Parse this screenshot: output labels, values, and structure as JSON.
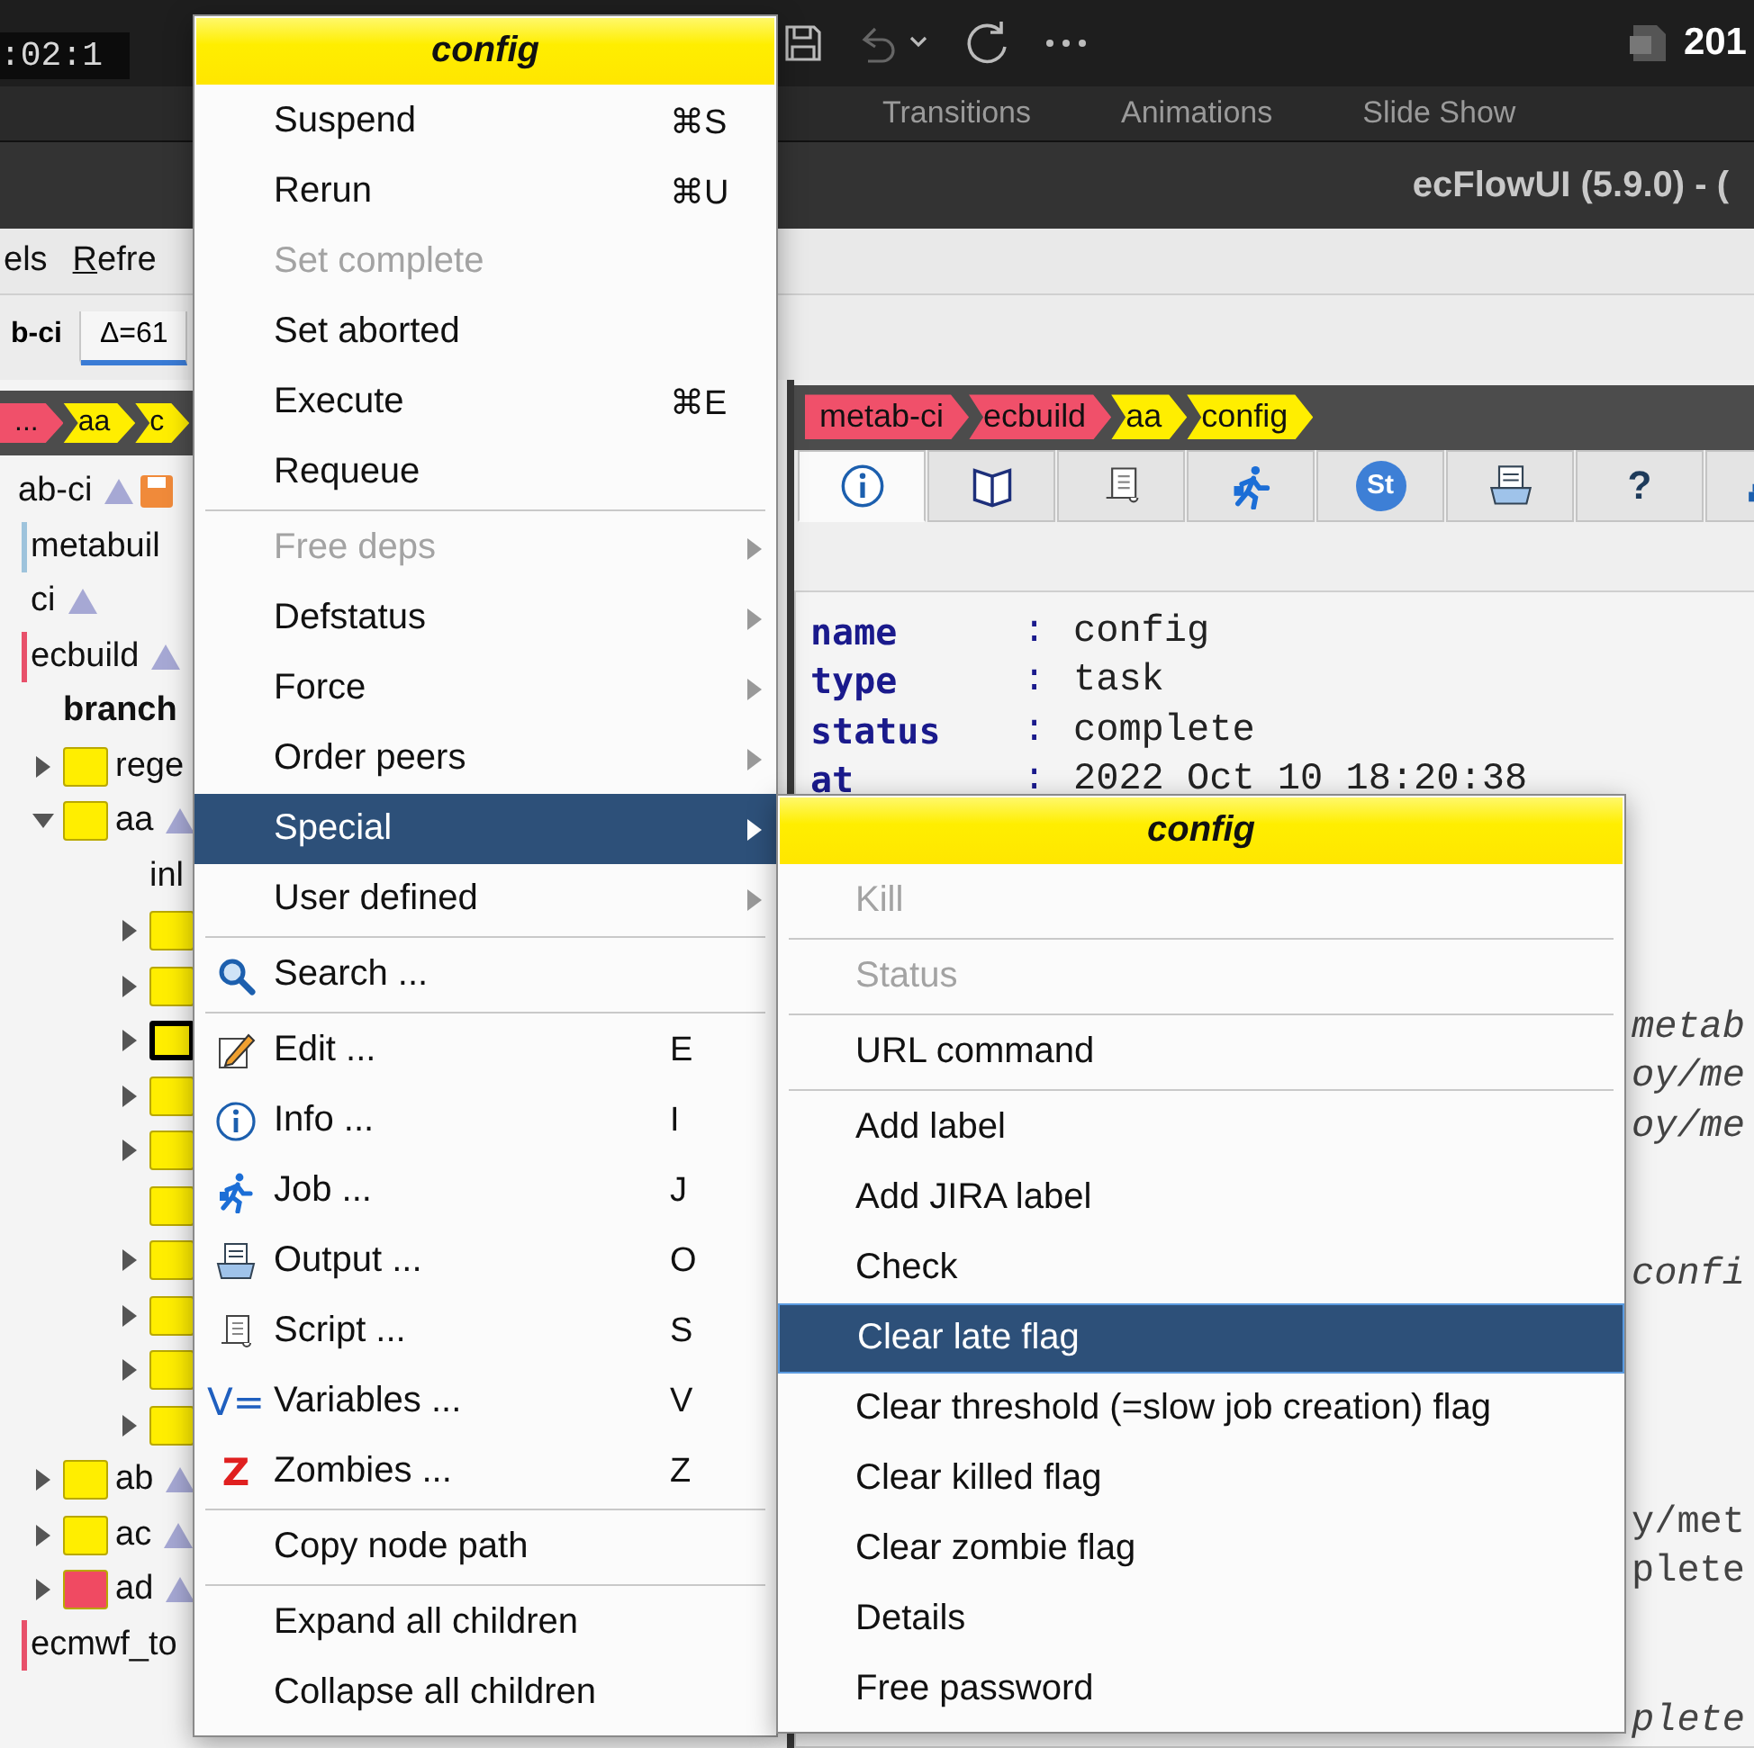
{
  "topbar": {
    "timer": ":02:1",
    "doc_title": "201"
  },
  "ribbon_tabs": [
    "Transitions",
    "Animations",
    "Slide Show"
  ],
  "window": {
    "title": "ecFlowUI (5.9.0) - ("
  },
  "menubar": [
    {
      "label": "els"
    },
    {
      "label": "Refre"
    }
  ],
  "server_tabs": [
    {
      "label": "b-ci",
      "selected": false
    },
    {
      "label": "Δ=61",
      "selected": true
    }
  ],
  "sidebar": {
    "breadcrumb": [
      {
        "label": "...",
        "color": "#f0506a"
      },
      {
        "label": "aa",
        "color": "#ffee00"
      },
      {
        "label": "c",
        "color": "#ffee00"
      }
    ],
    "tree": [
      {
        "kind": "suite",
        "label": "ab-ci",
        "selected": false,
        "children": [
          {
            "kind": "family",
            "label": "metabuil",
            "color": "#9ec3dc",
            "flagged": false,
            "selected": false
          },
          {
            "kind": "family",
            "label": "ci",
            "flagged": true,
            "selected": false
          },
          {
            "kind": "family",
            "label": "ecbuild",
            "color": "#e8506a",
            "flagged": true,
            "selected": false,
            "children": [
              {
                "kind": "heading",
                "label": "branch",
                "selected": false
              },
              {
                "kind": "node",
                "label": "rege",
                "color": "#ffee00",
                "expanded": false,
                "flagged": false,
                "selected": false
              },
              {
                "kind": "node",
                "label": "aa",
                "color": "#ffee00",
                "expanded": true,
                "flagged": true,
                "selected": false,
                "children": [
                  {
                    "kind": "label",
                    "label": "inl",
                    "selected": false
                  },
                  {
                    "kind": "node",
                    "color": "#ffee00",
                    "expanded": false,
                    "selected": false
                  },
                  {
                    "kind": "node",
                    "color": "#ffee00",
                    "expanded": false,
                    "selected": false
                  },
                  {
                    "kind": "node",
                    "color": "#ffee00",
                    "expanded": false,
                    "selected": true
                  },
                  {
                    "kind": "node",
                    "color": "#ffee00",
                    "expanded": false,
                    "selected": false
                  },
                  {
                    "kind": "node",
                    "color": "#ffee00",
                    "expanded": false,
                    "selected": false
                  },
                  {
                    "kind": "node",
                    "color": "#ffee00",
                    "selected": false
                  },
                  {
                    "kind": "node",
                    "color": "#ffee00",
                    "expanded": false,
                    "selected": false
                  },
                  {
                    "kind": "node",
                    "color": "#ffee00",
                    "expanded": false,
                    "selected": false
                  },
                  {
                    "kind": "node",
                    "color": "#ffee00",
                    "expanded": false,
                    "selected": false
                  },
                  {
                    "kind": "node",
                    "color": "#ffee00",
                    "expanded": false,
                    "selected": false
                  }
                ]
              },
              {
                "kind": "node",
                "label": "ab",
                "color": "#ffee00",
                "expanded": false,
                "flagged": true,
                "selected": false
              },
              {
                "kind": "node",
                "label": "ac",
                "color": "#ffee00",
                "expanded": false,
                "flagged": true,
                "selected": false
              },
              {
                "kind": "node",
                "label": "ad",
                "color": "#f04a62",
                "expanded": false,
                "flagged": true,
                "selected": false
              }
            ]
          },
          {
            "kind": "family",
            "label": "ecmwf_to",
            "color": "#e8506a",
            "flagged": false,
            "selected": false
          }
        ]
      }
    ]
  },
  "info_panel": {
    "breadcrumb": [
      {
        "label": "metab-ci",
        "color": "#f0506a"
      },
      {
        "label": "ecbuild",
        "color": "#f0506a"
      },
      {
        "label": "aa",
        "color": "#ffee00"
      },
      {
        "label": "config",
        "color": "#ffee00"
      }
    ],
    "tabs": [
      {
        "selected": true
      },
      {
        "selected": false
      },
      {
        "selected": false
      },
      {
        "selected": false
      },
      {
        "selected": false,
        "text": "St"
      },
      {
        "selected": false
      },
      {
        "selected": false,
        "text": "?"
      },
      {
        "selected": false
      }
    ],
    "lines": [
      {
        "key": "name",
        "colon": ":",
        "value": "config"
      },
      {
        "key": "type",
        "colon": ":",
        "value": "task"
      },
      {
        "key": "status",
        "colon": ":",
        "value": "complete"
      },
      {
        "key": "at",
        "colon": ":",
        "value": "2022 Oct 10 18:20:38"
      }
    ],
    "cut_blocks": [
      [
        {
          "text": "metab",
          "italic": true
        },
        {
          "text": "oy/me",
          "italic": true
        },
        {
          "text": "oy/me",
          "italic": true
        }
      ],
      [
        {
          "text": "confi",
          "italic": true
        }
      ],
      [
        {
          "text": "y/met",
          "italic": false
        },
        {
          "text": "plete",
          "italic": false
        }
      ],
      [
        {
          "text": "plete",
          "italic": true
        }
      ]
    ]
  },
  "context_menu": {
    "title": "config",
    "items": [
      {
        "kind": "item",
        "label": "Suspend",
        "shortcut": "⌘S",
        "disabled": false,
        "submenu": false,
        "selected": false
      },
      {
        "kind": "item",
        "label": "Rerun",
        "shortcut": "⌘U",
        "disabled": false,
        "submenu": false,
        "selected": false
      },
      {
        "kind": "item",
        "label": "Set complete",
        "disabled": true,
        "submenu": false,
        "selected": false
      },
      {
        "kind": "item",
        "label": "Set aborted",
        "disabled": false,
        "submenu": false,
        "selected": false
      },
      {
        "kind": "item",
        "label": "Execute",
        "shortcut": "⌘E",
        "disabled": false,
        "submenu": false,
        "selected": false
      },
      {
        "kind": "item",
        "label": "Requeue",
        "disabled": false,
        "submenu": false,
        "selected": false
      },
      {
        "kind": "separator"
      },
      {
        "kind": "item",
        "label": "Free deps",
        "disabled": true,
        "submenu": true,
        "selected": false
      },
      {
        "kind": "item",
        "label": "Defstatus",
        "disabled": false,
        "submenu": true,
        "selected": false
      },
      {
        "kind": "item",
        "label": "Force",
        "disabled": false,
        "submenu": true,
        "selected": false
      },
      {
        "kind": "item",
        "label": "Order peers",
        "disabled": false,
        "submenu": true,
        "selected": false
      },
      {
        "kind": "item",
        "label": "Special",
        "disabled": false,
        "submenu": true,
        "selected": true
      },
      {
        "kind": "item",
        "label": "User defined",
        "disabled": false,
        "submenu": true,
        "selected": false
      },
      {
        "kind": "separator"
      },
      {
        "kind": "item",
        "label": "Search ...",
        "disabled": false,
        "submenu": false,
        "selected": false
      },
      {
        "kind": "separator"
      },
      {
        "kind": "item",
        "label": "Edit ...",
        "shortcut": "E",
        "disabled": false,
        "submenu": false,
        "selected": false
      },
      {
        "kind": "item",
        "label": "Info ...",
        "shortcut": "I",
        "disabled": false,
        "submenu": false,
        "selected": false
      },
      {
        "kind": "item",
        "label": "Job ...",
        "shortcut": "J",
        "disabled": false,
        "submenu": false,
        "selected": false
      },
      {
        "kind": "item",
        "label": "Output ...",
        "shortcut": "O",
        "disabled": false,
        "submenu": false,
        "selected": false
      },
      {
        "kind": "item",
        "label": "Script ...",
        "shortcut": "S",
        "disabled": false,
        "submenu": false,
        "selected": false
      },
      {
        "kind": "item",
        "label": "Variables ...",
        "shortcut": "V",
        "icon_text": "V=",
        "color": "#1f5fbf",
        "disabled": false,
        "submenu": false,
        "selected": false
      },
      {
        "kind": "item",
        "label": "Zombies ...",
        "shortcut": "Z",
        "icon_text": "Z",
        "color": "#e02020",
        "disabled": false,
        "submenu": false,
        "selected": false
      },
      {
        "kind": "separator"
      },
      {
        "kind": "item",
        "label": "Copy node path",
        "disabled": false,
        "submenu": false,
        "selected": false
      },
      {
        "kind": "separator"
      },
      {
        "kind": "item",
        "label": "Expand all children",
        "disabled": false,
        "submenu": false,
        "selected": false
      },
      {
        "kind": "item",
        "label": "Collapse all children",
        "disabled": false,
        "submenu": false,
        "selected": false
      }
    ]
  },
  "submenu": {
    "title": "config",
    "items": [
      {
        "kind": "item",
        "label": "Kill",
        "disabled": true,
        "selected": false
      },
      {
        "kind": "separator"
      },
      {
        "kind": "item",
        "label": "Status",
        "disabled": true,
        "selected": false
      },
      {
        "kind": "separator"
      },
      {
        "kind": "item",
        "label": "URL command",
        "disabled": false,
        "selected": false
      },
      {
        "kind": "separator"
      },
      {
        "kind": "item",
        "label": "Add label",
        "disabled": false,
        "selected": false
      },
      {
        "kind": "item",
        "label": "Add JIRA label",
        "disabled": false,
        "selected": false
      },
      {
        "kind": "item",
        "label": "Check",
        "disabled": false,
        "selected": false
      },
      {
        "kind": "item",
        "label": "Clear late flag",
        "disabled": false,
        "selected": true
      },
      {
        "kind": "item",
        "label": "Clear threshold (=slow job creation) flag",
        "disabled": false,
        "selected": false
      },
      {
        "kind": "item",
        "label": "Clear killed flag",
        "disabled": false,
        "selected": false
      },
      {
        "kind": "item",
        "label": "Clear zombie flag",
        "disabled": false,
        "selected": false
      },
      {
        "kind": "item",
        "label": "Details",
        "disabled": false,
        "selected": false
      },
      {
        "kind": "item",
        "label": "Free password",
        "disabled": false,
        "selected": false
      }
    ]
  }
}
